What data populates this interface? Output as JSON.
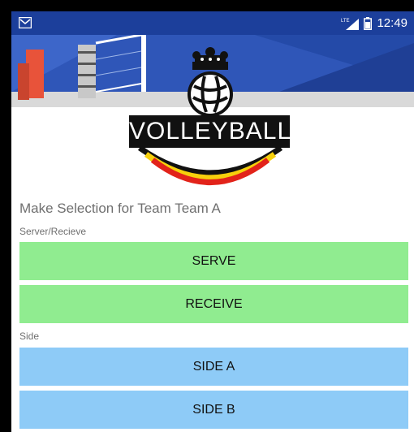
{
  "status_bar": {
    "time": "12:49",
    "network": "LTE",
    "left_icon": "email-notification-icon",
    "colors": {
      "background": "#1c3f9b"
    }
  },
  "header": {
    "logo_text": "VOLLEYBALL",
    "logo_icons": [
      "crown-icon",
      "volleyball-icon"
    ],
    "flag_colors": [
      "#111111",
      "#f6d00c",
      "#e2231a"
    ]
  },
  "selection": {
    "title": "Make Selection for Team Team A",
    "serve_receive_label": "Server/Recieve",
    "serve_label": "SERVE",
    "receive_label": "RECEIVE",
    "side_label": "Side",
    "side_a_label": "SIDE A",
    "side_b_label": "SIDE B"
  },
  "colors": {
    "serve_buttons": "#90ec90",
    "side_buttons": "#8ecbf7",
    "label_text": "#6f6f6f"
  }
}
